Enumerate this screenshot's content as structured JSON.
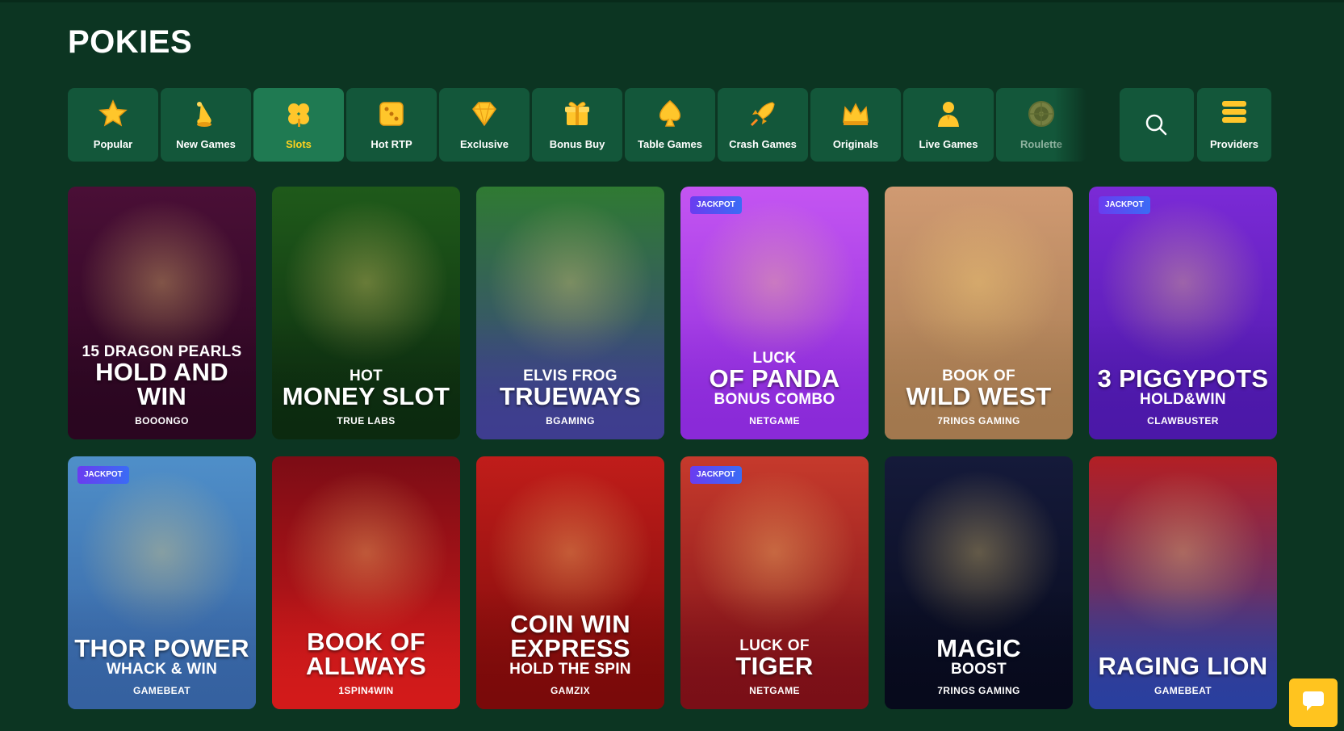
{
  "page": {
    "title": "POKIES"
  },
  "categories": [
    {
      "label": "Popular",
      "icon": "star-icon"
    },
    {
      "label": "New Games",
      "icon": "bell-icon"
    },
    {
      "label": "Slots",
      "icon": "clover-icon",
      "active": true
    },
    {
      "label": "Hot RTP",
      "icon": "dice-icon"
    },
    {
      "label": "Exclusive",
      "icon": "diamond-icon"
    },
    {
      "label": "Bonus Buy",
      "icon": "gift-icon"
    },
    {
      "label": "Table Games",
      "icon": "spade-icon"
    },
    {
      "label": "Crash Games",
      "icon": "rocket-icon"
    },
    {
      "label": "Originals",
      "icon": "crown-icon"
    },
    {
      "label": "Live Games",
      "icon": "dealer-icon"
    },
    {
      "label": "Roulette",
      "icon": "roulette-icon"
    }
  ],
  "search": {
    "icon": "search-icon"
  },
  "providers": {
    "label": "Providers",
    "icon": "stack-icon"
  },
  "jackpot_label": "JACKPOT",
  "games": [
    {
      "pre": "15 DRAGON PEARLS",
      "main": "HOLD AND WIN",
      "sub": "",
      "provider": "BOOONGO",
      "jackpot": false,
      "colors": [
        "#4a0f36",
        "#2a0620"
      ]
    },
    {
      "pre": "HOT",
      "main": "MONEY SLOT",
      "sub": "",
      "provider": "TRUE LABS",
      "jackpot": false,
      "colors": [
        "#1f5a1a",
        "#0c2a0f"
      ]
    },
    {
      "pre": "ELVIS FROG",
      "main": "TRUEWAYS",
      "sub": "",
      "provider": "BGAMING",
      "jackpot": false,
      "colors": [
        "#2f7a32",
        "#3e3d8f"
      ]
    },
    {
      "pre": "LUCK",
      "main": "OF PANDA",
      "sub": "BONUS COMBO",
      "provider": "NETGAME",
      "jackpot": true,
      "colors": [
        "#c455f2",
        "#8a2ad8"
      ]
    },
    {
      "pre": "BOOK OF",
      "main": "WILD WEST",
      "sub": "",
      "provider": "7RINGS GAMING",
      "jackpot": false,
      "colors": [
        "#d09a72",
        "#a2784e"
      ]
    },
    {
      "pre": "",
      "main": "3 PIGGYPOTS",
      "sub": "HOLD&WIN",
      "provider": "CLAWBUSTER",
      "jackpot": true,
      "colors": [
        "#7b2ad6",
        "#4b18a8"
      ]
    },
    {
      "pre": "",
      "main": "THOR POWER",
      "sub": "WHACK & WIN",
      "provider": "GAMEBEAT",
      "jackpot": true,
      "colors": [
        "#4f8fc9",
        "#3561a0"
      ]
    },
    {
      "pre": "",
      "main": "BOOK OF ALLWAYS",
      "sub": "",
      "provider": "1SPIN4WIN",
      "jackpot": false,
      "colors": [
        "#7c0c15",
        "#d21a1a"
      ]
    },
    {
      "pre": "",
      "main": "COIN WIN EXPRESS",
      "sub": "HOLD THE SPIN",
      "provider": "GAMZIX",
      "jackpot": false,
      "colors": [
        "#c01d1a",
        "#7a0a0a"
      ]
    },
    {
      "pre": "LUCK OF",
      "main": "TIGER",
      "sub": "",
      "provider": "NETGAME",
      "jackpot": true,
      "colors": [
        "#c63a2c",
        "#7a0f17"
      ]
    },
    {
      "pre": "",
      "main": "MAGIC",
      "sub": "BOOST",
      "provider": "7RINGS GAMING",
      "jackpot": false,
      "colors": [
        "#151a3a",
        "#070a1c"
      ]
    },
    {
      "pre": "",
      "main": "RAGING LION",
      "sub": "",
      "provider": "GAMEBEAT",
      "jackpot": false,
      "colors": [
        "#b31f24",
        "#2a3f9e"
      ]
    }
  ],
  "chat": {
    "icon": "chat-bubble-icon"
  }
}
